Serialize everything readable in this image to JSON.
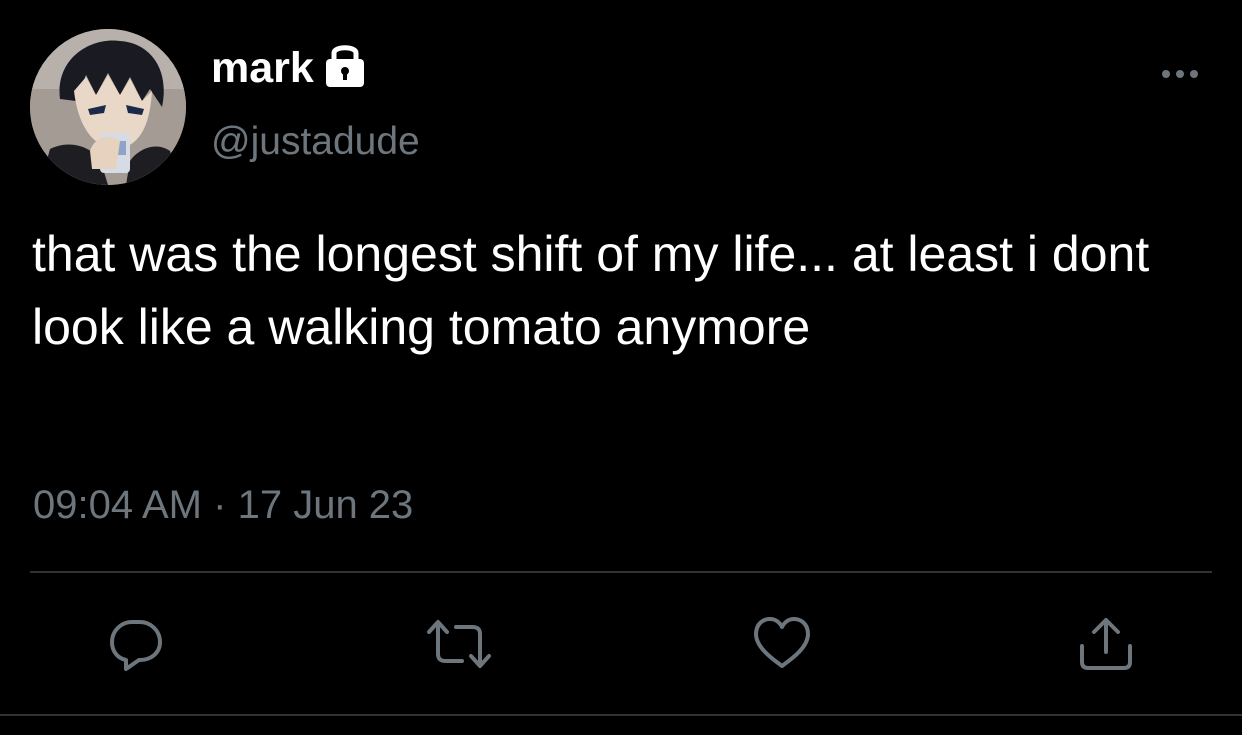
{
  "tweet": {
    "display_name": "mark",
    "handle": "@justadude",
    "text": "that was the longest shift of my life... at least i dont look like a walking tomato anymore",
    "time": "09:04 AM",
    "separator": "·",
    "date": "17 Jun 23",
    "more_icon": "more-horizontal-icon",
    "lock_icon": "lock-icon",
    "avatar": "anime-character-avatar"
  },
  "actions": [
    {
      "icon": "reply-icon"
    },
    {
      "icon": "retweet-icon"
    },
    {
      "icon": "like-icon"
    },
    {
      "icon": "share-icon"
    }
  ],
  "colors": {
    "background": "#000000",
    "text_primary": "#ffffff",
    "text_secondary": "#6e767d",
    "icon": "#6e767d",
    "divider": "#2f3336"
  }
}
